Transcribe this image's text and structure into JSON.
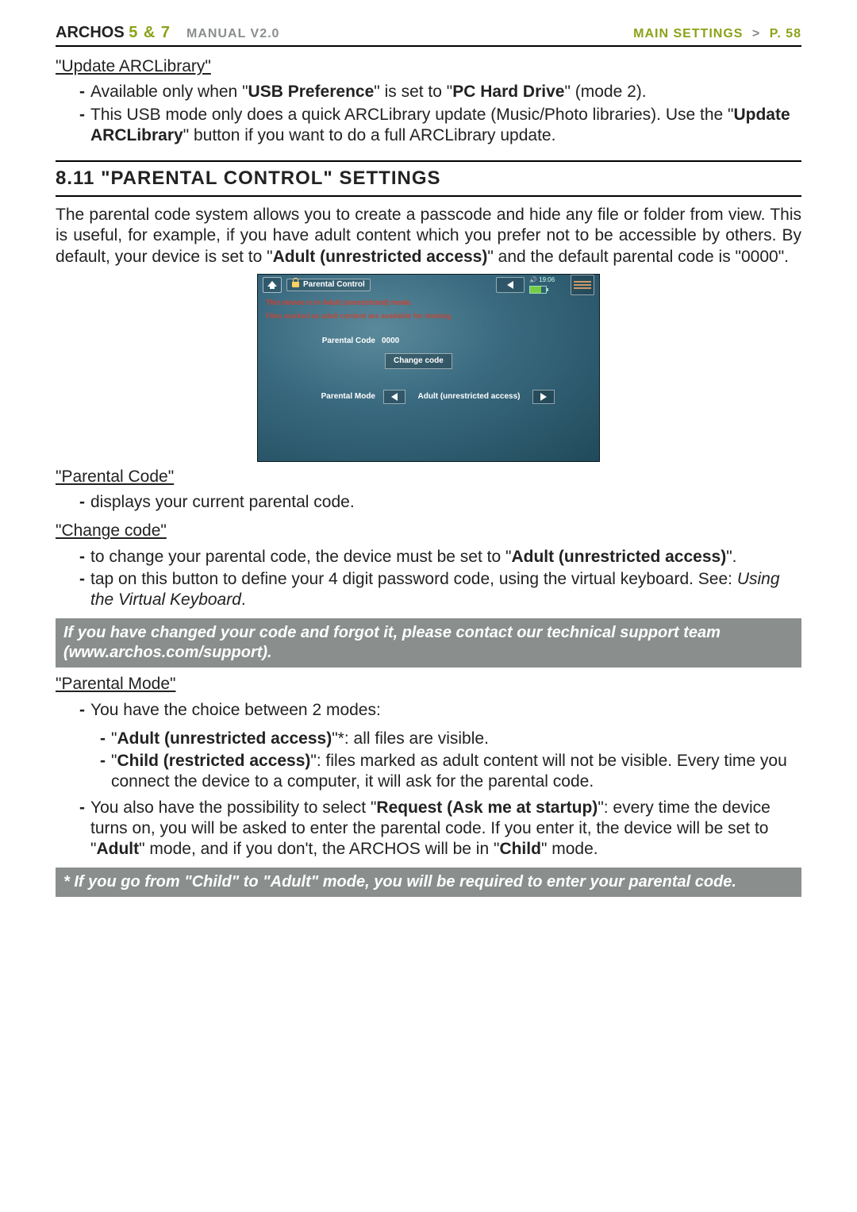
{
  "header": {
    "brand": "ARCHOS",
    "models": "5 & 7",
    "manual": "MANUAL",
    "version": "V2.0",
    "breadcrumb_section": "MAIN SETTINGS",
    "breadcrumb_gt": ">",
    "breadcrumb_page": "P. 58"
  },
  "arclib": {
    "title": "\"Update ARCLibrary\"",
    "b1_pre": "Available only when \"",
    "b1_bold1": "USB Preference",
    "b1_mid": "\" is set to \"",
    "b1_bold2": "PC Hard Drive",
    "b1_post": "\" (mode 2).",
    "b2_pre": "This USB mode only does a quick ARCLibrary update (Music/Photo libraries). Use the \"",
    "b2_bold": "Update ARCLibrary",
    "b2_post": "\" button if you want to do a full ARCLibrary update."
  },
  "section": {
    "number": "8.11",
    "title": "\"PARENTAL CONTROL\" SETTINGS"
  },
  "intro": {
    "p1_pre": "The parental code system allows you to create a passcode and hide any file or folder from view. This is useful, for example, if you have adult content which you prefer not to be accessible by others. By default, your device is set to \"",
    "p1_bold": "Adult (unrestricted access)",
    "p1_post": "\" and the default parental code is \"0000\"."
  },
  "device": {
    "title": "Parental Control",
    "time": "19:06",
    "warn1": "This device is in Adult (unrestricted) mode.",
    "warn2": "Files marked as adult content are available for viewing.",
    "code_label": "Parental Code",
    "code_value": "0000",
    "change_btn": "Change code",
    "mode_label": "Parental Mode",
    "mode_value": "Adult (unrestricted access)"
  },
  "parentalCode": {
    "title": "\"Parental Code\"",
    "b1": "displays your current parental code."
  },
  "changeCode": {
    "title": "\"Change code\"",
    "b1_pre": "to change your parental code, the device must be set to \"",
    "b1_bold": "Adult (unrestricted access)",
    "b1_post": "\".",
    "b2_pre": "tap on this button to define your 4 digit password code, using the virtual keyboard. See: ",
    "b2_ital": "Using the Virtual Keyboard",
    "b2_post": "."
  },
  "note1": "If you have changed your code and forgot it, please contact our technical support team (www.archos.com/support).",
  "parentalMode": {
    "title": "\"Parental Mode\"",
    "b1": "You have the choice between 2 modes:",
    "m1_pre": "\"",
    "m1_bold": "Adult (unrestricted access)",
    "m1_post": "\"*: all files are visible.",
    "m2_pre": "\"",
    "m2_bold": "Child (restricted access)",
    "m2_post": "\": files marked as adult content will not be visible. Every time you connect the device to a computer, it will ask for the parental code.",
    "b2_pre": "You also have the possibility to select \"",
    "b2_bold1": "Request (Ask me at startup)",
    "b2_mid": "\": every time the device turns on, you will be asked to enter the parental code. If you enter it, the device will be set to \"",
    "b2_bold2": "Adult",
    "b2_mid2": "\" mode, and if you don't, the ARCHOS will be in \"",
    "b2_bold3": "Child",
    "b2_post": "\" mode."
  },
  "note2": "* If you go from \"Child\" to \"Adult\" mode, you will be required to enter your parental code."
}
